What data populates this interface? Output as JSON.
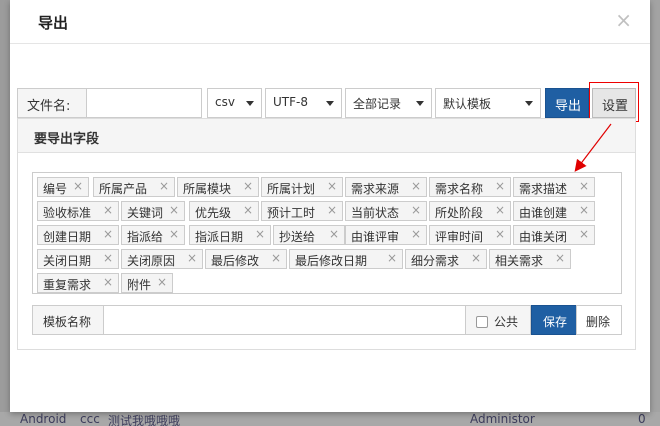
{
  "dialog": {
    "title": "导出",
    "close": "×"
  },
  "toolbar": {
    "filename_label": "文件名:",
    "filename_value": "",
    "format": "csv",
    "encoding": "UTF-8",
    "range": "全部记录",
    "template": "默认模板",
    "export_button": "导出",
    "settings_button": "设置"
  },
  "fields_panel": {
    "title": "要导出字段",
    "chips": [
      "编号",
      "所属产品",
      "所属模块",
      "所属计划",
      "需求来源",
      "需求名称",
      "需求描述",
      "验收标准",
      "关键词",
      "优先级",
      "预计工时",
      "当前状态",
      "所处阶段",
      "由谁创建",
      "创建日期",
      "指派给",
      "指派日期",
      "抄送给",
      "由谁评审",
      "评审时间",
      "由谁关闭",
      "关闭日期",
      "关闭原因",
      "最后修改",
      "最后修改日期",
      "细分需求",
      "相关需求",
      "重复需求",
      "附件"
    ],
    "remove_glyph": "×"
  },
  "template_row": {
    "name_label": "模板名称",
    "name_value": "",
    "public_label": "公共",
    "public_checked": false,
    "save_button": "保存",
    "delete_button": "删除"
  },
  "background": {
    "row_text": [
      "Android",
      "ccc",
      "测试我哦哦哦",
      "Administor"
    ],
    "right_count": "0"
  },
  "colors": {
    "primary": "#1f5fa3",
    "annotation": "#e00000"
  }
}
